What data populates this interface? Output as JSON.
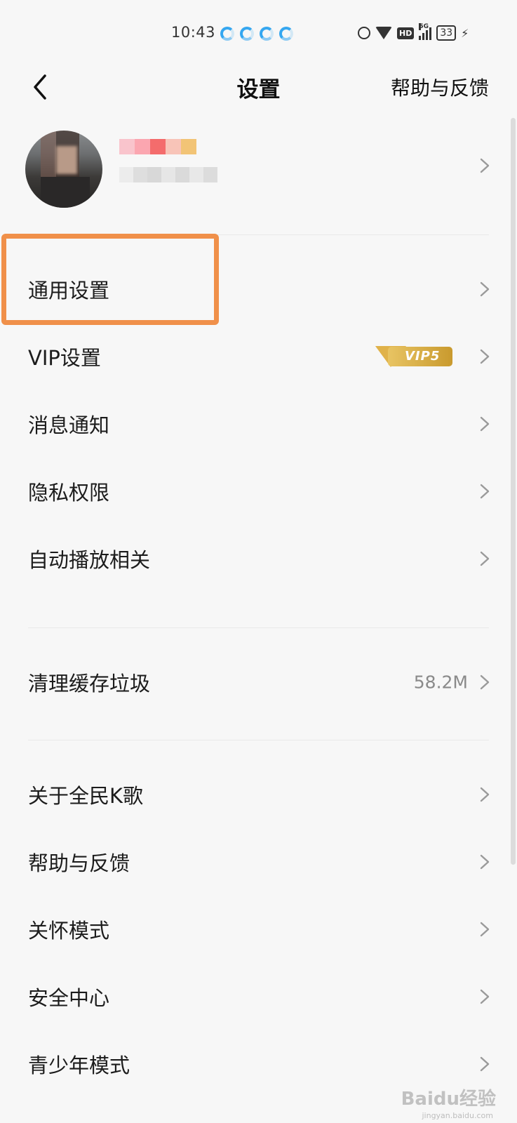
{
  "status_bar": {
    "time": "10:43",
    "hd": "HD",
    "network": "5G",
    "battery": "33",
    "loader_color": "#35a7f0"
  },
  "header": {
    "title": "设置",
    "help_link": "帮助与反馈"
  },
  "profile": {
    "avatar": "avatar-icon",
    "nickname_blurred": true
  },
  "settings": {
    "general": "通用设置",
    "vip": "VIP设置",
    "vip_badge": "VIP5",
    "message": "消息通知",
    "privacy": "隐私权限",
    "autoplay": "自动播放相关",
    "clear_cache": "清理缓存垃圾",
    "cache_size": "58.2M",
    "about": "关于全民K歌",
    "help": "帮助与反馈",
    "care": "关怀模式",
    "security": "安全中心",
    "teen": "青少年模式"
  },
  "highlight_color": "#f0904a",
  "watermark": {
    "text": "Baidu经验",
    "sub": "jingyan.baidu.com"
  }
}
